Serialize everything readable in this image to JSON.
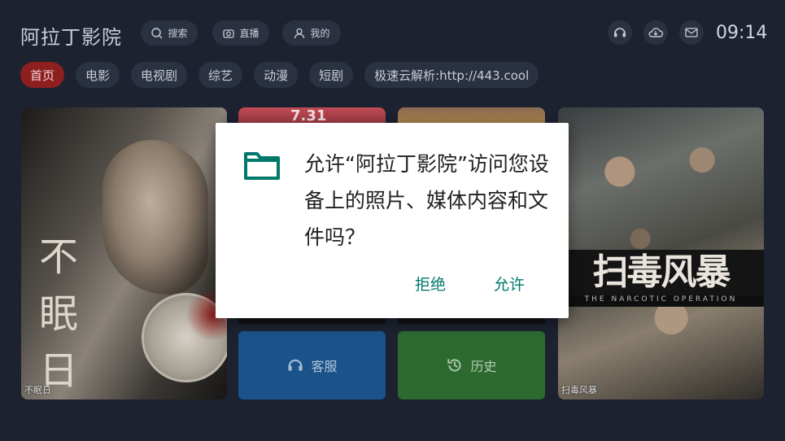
{
  "header": {
    "app_title": "阿拉丁影院",
    "search_label": "搜索",
    "live_label": "直播",
    "mine_label": "我的",
    "clock": "09:14"
  },
  "nav": {
    "items": [
      {
        "label": "首页"
      },
      {
        "label": "电影"
      },
      {
        "label": "电视剧"
      },
      {
        "label": "综艺"
      },
      {
        "label": "动漫"
      },
      {
        "label": "短剧"
      },
      {
        "label": "极速云解析:http://443.cool"
      }
    ]
  },
  "content": {
    "poster_left": {
      "title": "不眠日",
      "big_text": [
        "不",
        "眠",
        "日"
      ]
    },
    "mini_a_text": "7.31",
    "poster_right": {
      "title": "扫毒风暴",
      "banner": "扫毒风暴",
      "banner_sub": "THE NARCOTIC OPERATION"
    },
    "tile_service": "客服",
    "tile_history": "历史"
  },
  "dialog": {
    "message": "允许“阿拉丁影院”访问您设备上的照片、媒体内容和文件吗？",
    "deny_label": "拒绝",
    "allow_label": "允许"
  },
  "colors": {
    "background": "#1c2230",
    "active_nav": "#8e1f1f",
    "dialog_accent": "#00796b",
    "tile_service": "#1b528a",
    "tile_history": "#2c6a30"
  },
  "icons": [
    "search-icon",
    "camera-icon",
    "user-icon",
    "headset-icon",
    "cloud-icon",
    "mail-icon",
    "folder-icon",
    "history-icon"
  ]
}
